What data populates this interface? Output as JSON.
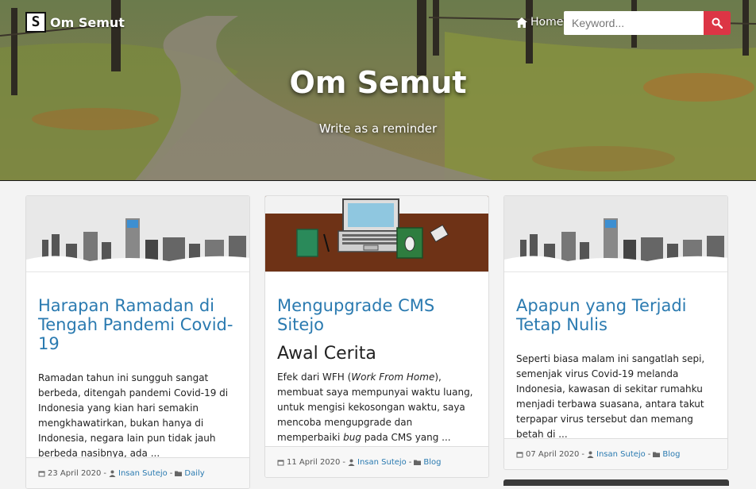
{
  "header": {
    "brand_logo_letter": "S",
    "brand_name": "Om Semut",
    "nav_home": "Home",
    "search_placeholder": "Keyword...",
    "title": "Om Semut",
    "subtitle": "Write as a reminder"
  },
  "posts": [
    {
      "title": "Harapan Ramadan di Tengah Pandemi Covid-19",
      "subheading": "",
      "excerpt": "Ramadan tahun ini sungguh sangat berbeda, ditengah pandemi Covid-19 di Indonesia yang kian hari semakin mengkhawatirkan, bukan hanya di Indonesia, negara lain pun tidak jauh berbeda nasibnya, ada ...",
      "date": "23 April 2020",
      "author": "Insan Sutejo",
      "category": "Daily",
      "image": "city-skyline"
    },
    {
      "title": "Mengupgrade CMS Sitejo",
      "subheading": "Awal Cerita",
      "excerpt_pre": "Efek dari WFH (",
      "excerpt_em1": "Work From Home",
      "excerpt_mid": "), membuat saya mempunyai waktu luang, untuk mengisi kekosongan waktu, saya mencoba mengupgrade dan memperbaiki ",
      "excerpt_em2": "bug",
      "excerpt_post": " pada CMS yang ...",
      "date": "11 April 2020",
      "author": "Insan Sutejo",
      "category": "Blog",
      "image": "desk-laptop"
    },
    {
      "title": "Apapun yang Terjadi Tetap Nulis",
      "subheading": "",
      "excerpt": "Seperti biasa malam ini sangatlah sepi, semenjak virus Covid-19 melanda Indonesia, kawasan di sekitar rumahku menjadi terbawa suasana, antara takut terpapar virus tersebut dan memang betah di ...",
      "date": "07 April 2020",
      "author": "Insan Sutejo",
      "category": "Blog",
      "image": "city-skyline"
    }
  ],
  "meta_separator": "-",
  "colors": {
    "accent": "#2a7ab0",
    "search_button": "#dc3545"
  }
}
